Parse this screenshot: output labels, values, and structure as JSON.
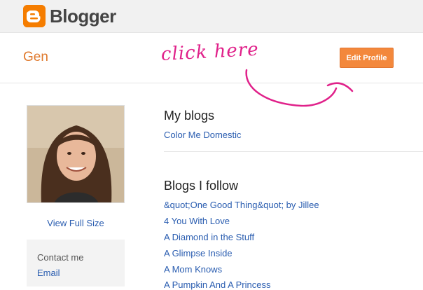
{
  "header": {
    "brand": "Blogger",
    "logo_icon": "blogger-logo-icon",
    "brand_color": "#f57d00"
  },
  "profile": {
    "name": "Gen",
    "edit_button": "Edit Profile",
    "annotation": "click here",
    "view_full_size": "View Full Size"
  },
  "contact": {
    "label": "Contact me",
    "email": "Email"
  },
  "my_blogs": {
    "title": "My blogs",
    "items": [
      "Color Me Domestic"
    ]
  },
  "blogs_following": {
    "title": "Blogs I follow",
    "items": [
      "&quot;One Good Thing&quot; by Jillee",
      "4 You With Love",
      "A Diamond in the Stuff",
      "A Glimpse Inside",
      "A Mom Knows",
      "A Pumpkin And A Princess"
    ]
  }
}
